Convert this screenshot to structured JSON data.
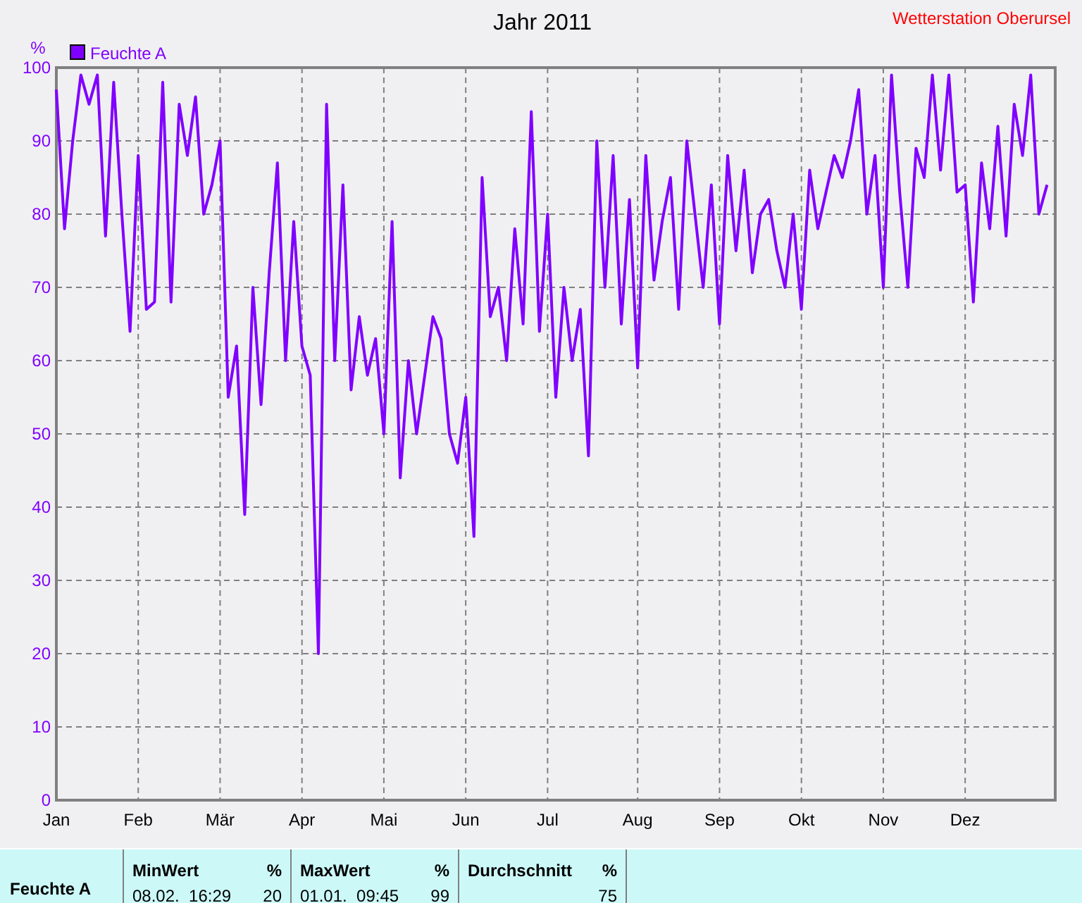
{
  "station": "Wetterstation Oberursel",
  "chart_data": {
    "type": "line",
    "grid": true,
    "title": "Jahr 2011",
    "ylabel": "%",
    "ylim": [
      0,
      100
    ],
    "yticks": [
      0,
      10,
      20,
      30,
      40,
      50,
      60,
      70,
      80,
      90,
      100
    ],
    "categories": [
      "Jan",
      null,
      null,
      null,
      null,
      null,
      null,
      null,
      null,
      null,
      "Feb",
      null,
      null,
      null,
      null,
      null,
      null,
      null,
      null,
      null,
      "Mär",
      null,
      null,
      null,
      null,
      null,
      null,
      null,
      null,
      null,
      "Apr",
      null,
      null,
      null,
      null,
      null,
      null,
      null,
      null,
      null,
      "Mai",
      null,
      null,
      null,
      null,
      null,
      null,
      null,
      null,
      null,
      "Jun",
      null,
      null,
      null,
      null,
      null,
      null,
      null,
      null,
      null,
      "Jul",
      null,
      null,
      null,
      null,
      null,
      null,
      null,
      null,
      null,
      null,
      "Aug",
      null,
      null,
      null,
      null,
      null,
      null,
      null,
      null,
      null,
      "Sep",
      null,
      null,
      null,
      null,
      null,
      null,
      null,
      null,
      null,
      "Okt",
      null,
      null,
      null,
      null,
      null,
      null,
      null,
      null,
      null,
      "Nov",
      null,
      null,
      null,
      null,
      null,
      null,
      null,
      null,
      null,
      "Dez",
      null,
      null,
      null,
      null,
      null,
      null,
      null,
      null,
      null,
      null
    ],
    "series": [
      {
        "name": "Feuchte A",
        "color": "#8000ff",
        "values": [
          97,
          78,
          90,
          99,
          95,
          99,
          77,
          98,
          80,
          64,
          88,
          67,
          68,
          98,
          68,
          95,
          88,
          96,
          80,
          84,
          90,
          55,
          62,
          39,
          70,
          54,
          72,
          87,
          60,
          79,
          62,
          58,
          20,
          95,
          60,
          84,
          56,
          66,
          58,
          63,
          50,
          79,
          44,
          60,
          50,
          58,
          66,
          63,
          50,
          46,
          55,
          36,
          85,
          66,
          70,
          60,
          78,
          65,
          94,
          64,
          80,
          55,
          70,
          60,
          67,
          47,
          90,
          70,
          88,
          65,
          82,
          59,
          88,
          71,
          79,
          85,
          67,
          90,
          80,
          70,
          84,
          65,
          88,
          75,
          86,
          72,
          80,
          82,
          75,
          70,
          80,
          67,
          86,
          78,
          83,
          88,
          85,
          90,
          97,
          80,
          88,
          70,
          99,
          83,
          70,
          89,
          85,
          99,
          86,
          99,
          83,
          84,
          68,
          87,
          78,
          92,
          77,
          95,
          88,
          99,
          80,
          84
        ]
      }
    ]
  },
  "summary": {
    "row_label": "Feuchte A",
    "columns": [
      {
        "heading": "MinWert",
        "unit": "%",
        "time": "08.02.  16:29",
        "value": "20"
      },
      {
        "heading": "MaxWert",
        "unit": "%",
        "time": "01.01.  09:45",
        "value": "99"
      },
      {
        "heading": "Durchschnitt",
        "unit": "%",
        "value": "75"
      }
    ]
  }
}
